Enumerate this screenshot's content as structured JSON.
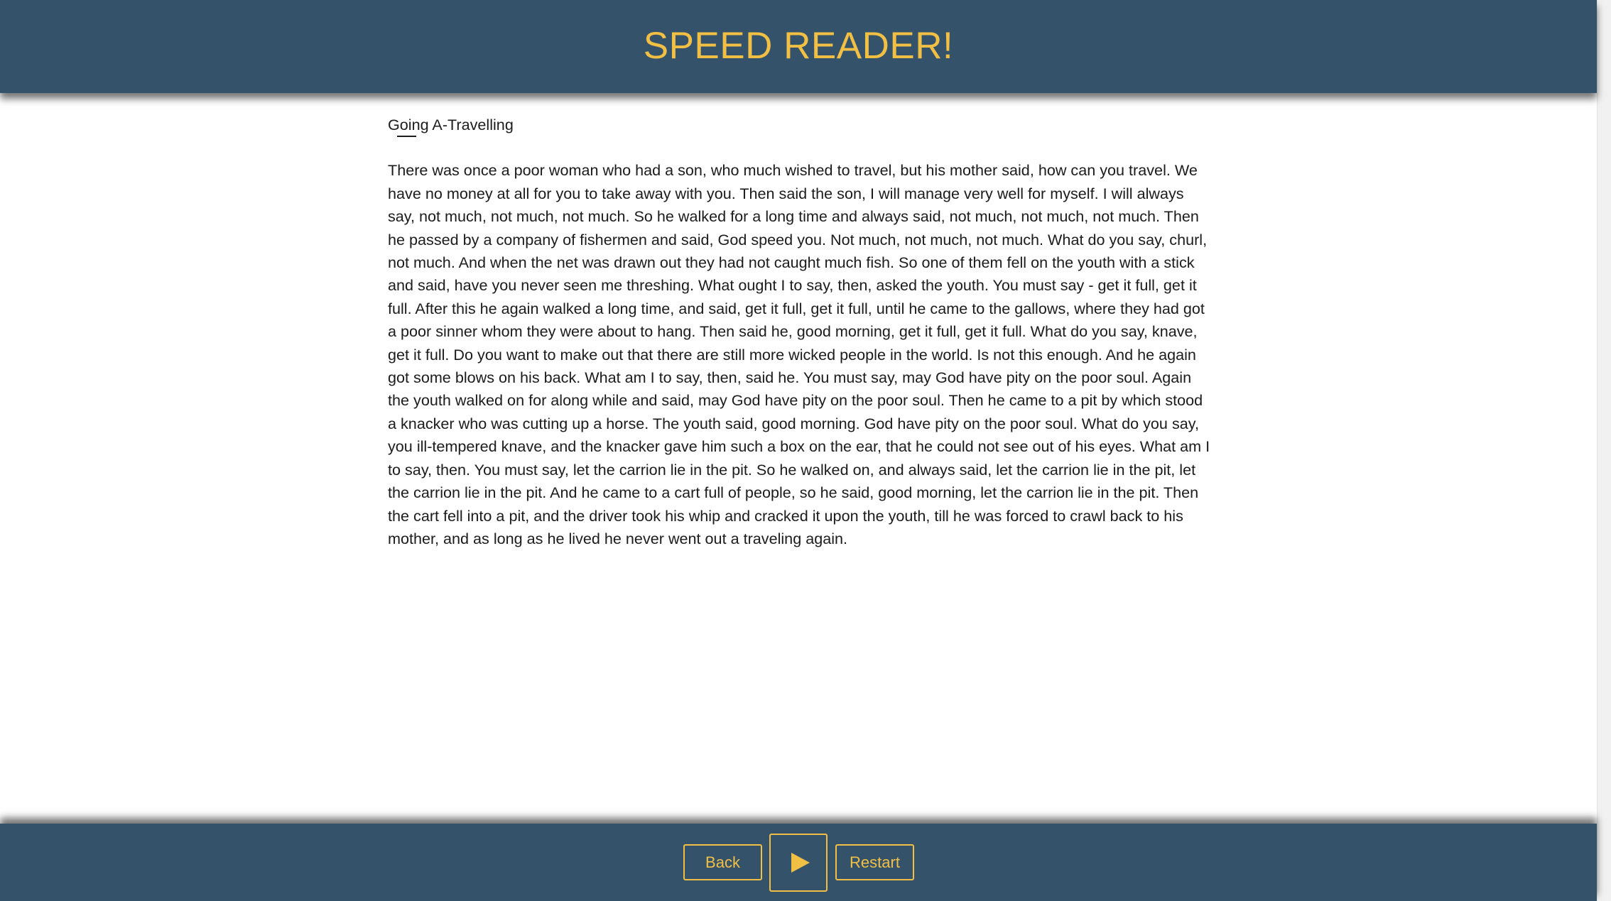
{
  "header": {
    "title": "SPEED READER!"
  },
  "story": {
    "title": "Going A-Travelling",
    "current_word": "Going",
    "body": "There was once a poor woman who had a son, who much wished to travel, but his mother said, how can you travel. We have no money at all for you to take away with you. Then said the son, I will manage very well for myself. I will always say, not much, not much, not much. So he walked for a long time and always said, not much, not much, not much. Then he passed by a company of fishermen and said, God speed you. Not much, not much, not much. What do you say, churl, not much. And when the net was drawn out they had not caught much fish. So one of them fell on the youth with a stick and said, have you never seen me threshing. What ought I to say, then, asked the youth. You must say - get it full, get it full. After this he again walked a long time, and said, get it full, get it full, until he came to the gallows, where they had got a poor sinner whom they were about to hang. Then said he, good morning, get it full, get it full. What do you say, knave, get it full. Do you want to make out that there are still more wicked people in the world. Is not this enough. And he again got some blows on his back. What am I to say, then, said he. You must say, may God have pity on the poor soul. Again the youth walked on for along while and said, may God have pity on the poor soul. Then he came to a pit by which stood a knacker who was cutting up a horse. The youth said, good morning. God have pity on the poor soul. What do you say, you ill-tempered knave, and the knacker gave him such a box on the ear, that he could not see out of his eyes. What am I to say, then. You must say, let the carrion lie in the pit. So he walked on, and always said, let the carrion lie in the pit, let the carrion lie in the pit. And he came to a cart full of people, so he said, good morning, let the carrion lie in the pit. Then the cart fell into a pit, and the driver took his whip and cracked it upon the youth, till he was forced to crawl back to his mother, and as long as he lived he never went out a traveling again."
  },
  "controls": {
    "back_label": "Back",
    "play_icon": "play-icon",
    "restart_label": "Restart"
  },
  "colors": {
    "bar_background": "#34536b",
    "accent": "#f2bf45",
    "text": "#1b1b1b"
  }
}
